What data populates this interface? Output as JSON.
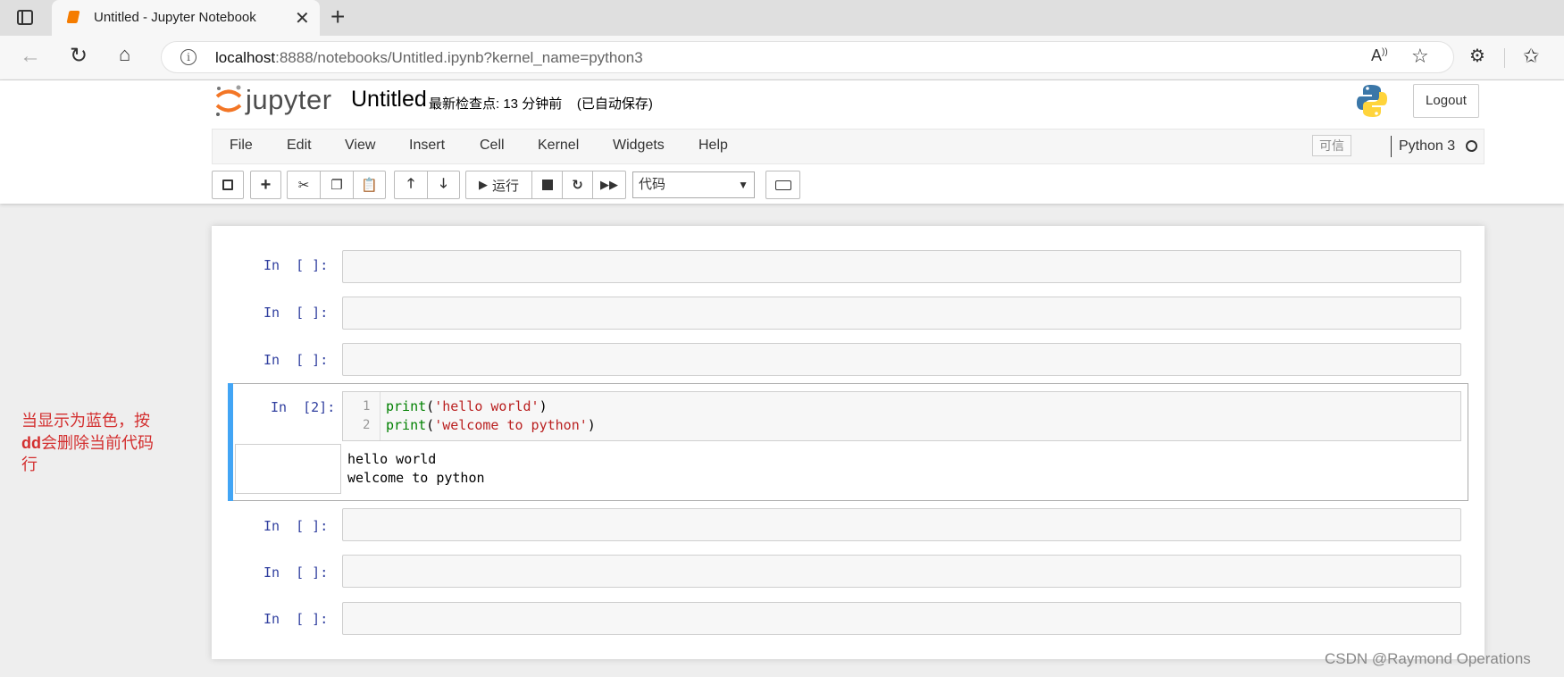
{
  "browser": {
    "tab_title": "Untitled - Jupyter Notebook",
    "url_host": "localhost",
    "url_rest": ":8888/notebooks/Untitled.ipynb?kernel_name=python3"
  },
  "jupyter": {
    "logo_text": "jupyter",
    "notebook_title": "Untitled",
    "checkpoint": "最新检查点: 13 分钟前",
    "autosave": "(已自动保存)",
    "logout_label": "Logout",
    "menu": [
      "File",
      "Edit",
      "View",
      "Insert",
      "Cell",
      "Kernel",
      "Widgets",
      "Help"
    ],
    "trusted_label": "可信",
    "kernel_name": "Python 3",
    "run_label": "运行",
    "cell_type": "代码"
  },
  "cells": {
    "empty_prompt": "In  [ ]:",
    "active_prompt": "In  [2]:",
    "code_lines": [
      {
        "num": "1",
        "fn": "print",
        "arg": "'hello world'"
      },
      {
        "num": "2",
        "fn": "print",
        "arg": "'welcome to python'"
      }
    ],
    "output_lines": [
      "hello world",
      "welcome to python"
    ]
  },
  "annotation": {
    "line1": "当显示为蓝色，按",
    "bold": "dd",
    "line2": "会删除当前代码",
    "line3": "行"
  },
  "watermark": "CSDN @Raymond Operations"
}
